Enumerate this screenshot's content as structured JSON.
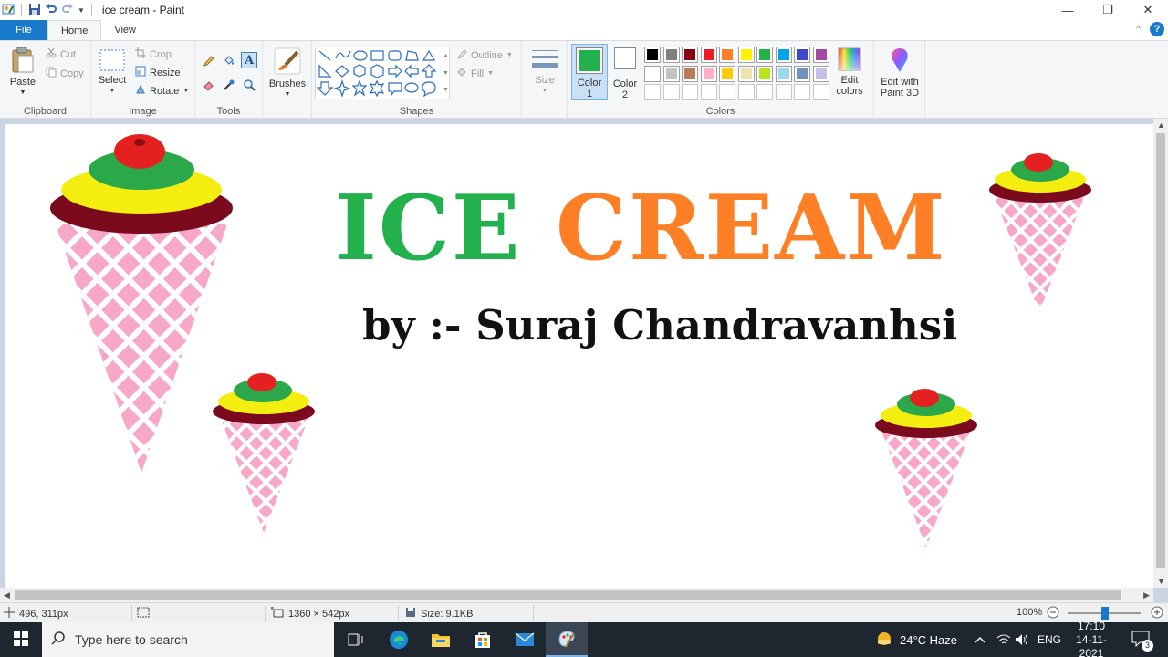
{
  "window": {
    "title": "ice cream - Paint",
    "controls": {
      "minimize": "—",
      "maximize": "❐",
      "close": "✕"
    }
  },
  "tabs": {
    "file": "File",
    "home": "Home",
    "view": "View",
    "collapse": "^",
    "help": "?"
  },
  "ribbon": {
    "clipboard": {
      "label": "Clipboard",
      "paste": "Paste",
      "cut": "Cut",
      "copy": "Copy"
    },
    "image": {
      "label": "Image",
      "select": "Select",
      "crop": "Crop",
      "resize": "Resize",
      "rotate": "Rotate"
    },
    "tools": {
      "label": "Tools"
    },
    "brushes": {
      "label": "Brushes"
    },
    "shapes": {
      "label": "Shapes",
      "outline": "Outline",
      "fill": "Fill"
    },
    "size": {
      "label": "Size"
    },
    "colors": {
      "label": "Colors",
      "color1_label": "Color",
      "color1_num": "1",
      "color2_label": "Color",
      "color2_num": "2",
      "color1": "#22b14c",
      "color2": "#ffffff",
      "edit_colors_line1": "Edit",
      "edit_colors_line2": "colors",
      "palette_row1": [
        "#000000",
        "#7f7f7f",
        "#880015",
        "#ed1c24",
        "#ff7f27",
        "#fff200",
        "#22b14c",
        "#00a2e8",
        "#3f48cc",
        "#a349a4"
      ],
      "palette_row2": [
        "#ffffff",
        "#c3c3c3",
        "#b97a57",
        "#ffaec9",
        "#ffc90e",
        "#efe4b0",
        "#b5e61d",
        "#99d9ea",
        "#7092be",
        "#c8bfe7"
      ]
    },
    "paint3d": {
      "line1": "Edit with",
      "line2": "Paint 3D"
    }
  },
  "canvas": {
    "title_word1": "ICE",
    "title_word2": "CREAM",
    "byline": "by :- Suraj Chandravanhsi"
  },
  "status": {
    "cursor_pos": "496, 311px",
    "canvas_size": "1360 × 542px",
    "file_size": "Size: 9.1KB",
    "zoom": "100%"
  },
  "taskbar": {
    "search_placeholder": "Type here to search",
    "weather": "24°C  Haze",
    "language": "ENG",
    "time": "17:10",
    "date": "14-11-2021",
    "notifications": "3"
  }
}
